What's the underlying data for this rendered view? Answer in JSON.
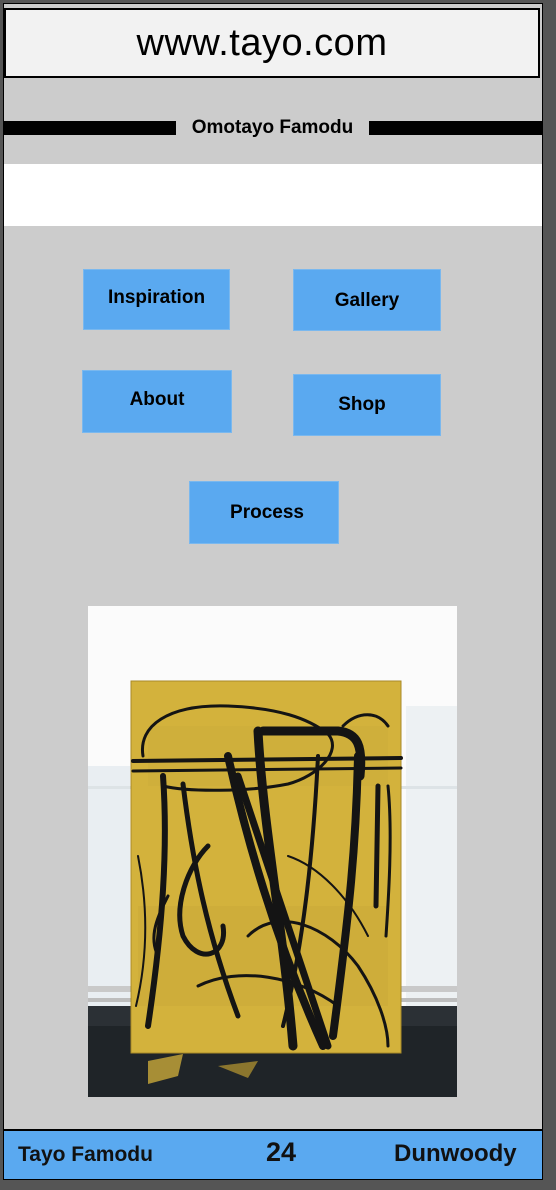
{
  "url_bar": {
    "text": "www.tayo.com"
  },
  "header": {
    "title": "Omotayo Famodu"
  },
  "nav": {
    "inspiration": "Inspiration",
    "gallery": "Gallery",
    "about": "About",
    "shop": "Shop",
    "process": "Process"
  },
  "artwork": {
    "icon": "abstract-painting-image"
  },
  "footer": {
    "name": "Tayo Famodu",
    "number": "24",
    "city": "Dunwoody"
  },
  "colors": {
    "background": "#cccccc",
    "button": "#5aa9f0",
    "painting": "#d3b23c"
  }
}
